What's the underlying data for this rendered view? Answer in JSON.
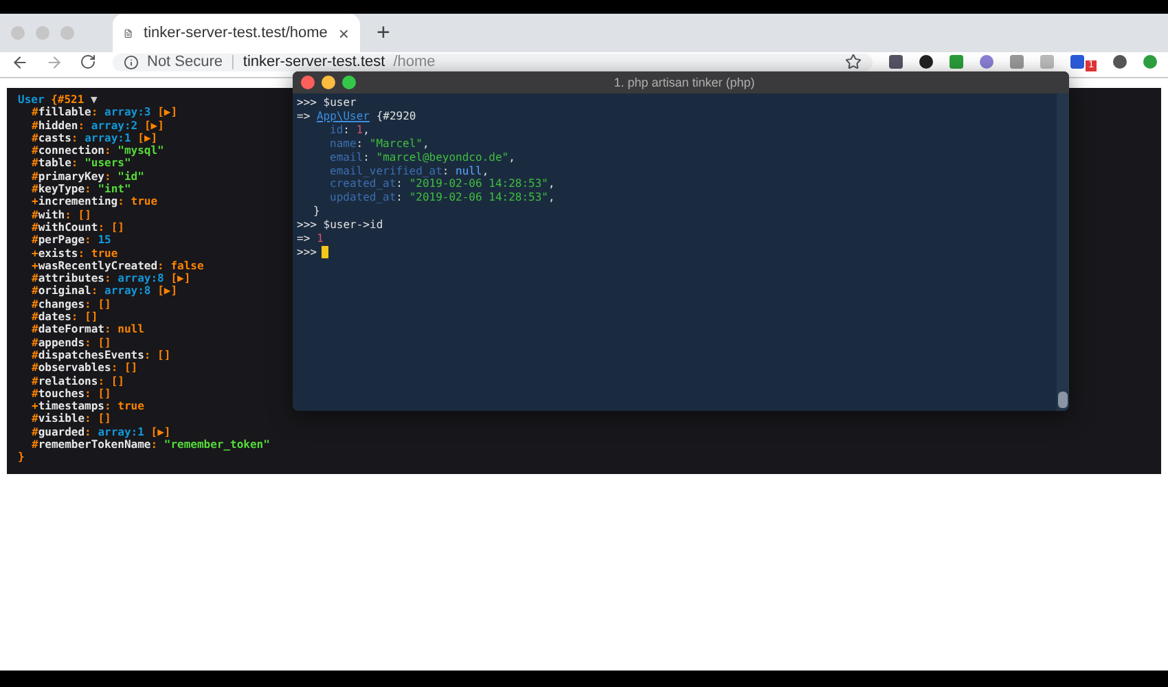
{
  "browser": {
    "tab": {
      "title": "tinker-server-test.test/home",
      "close": "×"
    },
    "new_tab": "+",
    "security": "Not Secure",
    "separator": "|",
    "url_host": "tinker-server-test.test",
    "url_path": "/home",
    "extension_badge": "1"
  },
  "dump": {
    "class": "User",
    "ref": "{#521",
    "toggle": "▼",
    "close": "}",
    "rows": [
      {
        "prefix": "#",
        "key": "fillable",
        "colon": ":",
        "kind": "array",
        "value": "array:3",
        "expander": "[▶]"
      },
      {
        "prefix": "#",
        "key": "hidden",
        "colon": ":",
        "kind": "array",
        "value": "array:2",
        "expander": "[▶]"
      },
      {
        "prefix": "#",
        "key": "casts",
        "colon": ":",
        "kind": "array",
        "value": "array:1",
        "expander": "[▶]"
      },
      {
        "prefix": "#",
        "key": "connection",
        "colon": ":",
        "kind": "string",
        "value": "\"mysql\""
      },
      {
        "prefix": "#",
        "key": "table",
        "colon": ":",
        "kind": "string",
        "value": "\"users\""
      },
      {
        "prefix": "#",
        "key": "primaryKey",
        "colon": ":",
        "kind": "string",
        "value": "\"id\""
      },
      {
        "prefix": "#",
        "key": "keyType",
        "colon": ":",
        "kind": "string",
        "value": "\"int\""
      },
      {
        "prefix": "+",
        "key": "incrementing",
        "colon": ":",
        "kind": "const",
        "value": "true"
      },
      {
        "prefix": "#",
        "key": "with",
        "colon": ":",
        "kind": "empty",
        "value": "[]"
      },
      {
        "prefix": "#",
        "key": "withCount",
        "colon": ":",
        "kind": "empty",
        "value": "[]"
      },
      {
        "prefix": "#",
        "key": "perPage",
        "colon": ":",
        "kind": "number",
        "value": "15"
      },
      {
        "prefix": "+",
        "key": "exists",
        "colon": ":",
        "kind": "const",
        "value": "true"
      },
      {
        "prefix": "+",
        "key": "wasRecentlyCreated",
        "colon": ":",
        "kind": "const",
        "value": "false"
      },
      {
        "prefix": "#",
        "key": "attributes",
        "colon": ":",
        "kind": "array",
        "value": "array:8",
        "expander": "[▶]"
      },
      {
        "prefix": "#",
        "key": "original",
        "colon": ":",
        "kind": "array",
        "value": "array:8",
        "expander": "[▶]"
      },
      {
        "prefix": "#",
        "key": "changes",
        "colon": ":",
        "kind": "empty",
        "value": "[]"
      },
      {
        "prefix": "#",
        "key": "dates",
        "colon": ":",
        "kind": "empty",
        "value": "[]"
      },
      {
        "prefix": "#",
        "key": "dateFormat",
        "colon": ":",
        "kind": "const",
        "value": "null"
      },
      {
        "prefix": "#",
        "key": "appends",
        "colon": ":",
        "kind": "empty",
        "value": "[]"
      },
      {
        "prefix": "#",
        "key": "dispatchesEvents",
        "colon": ":",
        "kind": "empty",
        "value": "[]"
      },
      {
        "prefix": "#",
        "key": "observables",
        "colon": ":",
        "kind": "empty",
        "value": "[]"
      },
      {
        "prefix": "#",
        "key": "relations",
        "colon": ":",
        "kind": "empty",
        "value": "[]"
      },
      {
        "prefix": "#",
        "key": "touches",
        "colon": ":",
        "kind": "empty",
        "value": "[]"
      },
      {
        "prefix": "+",
        "key": "timestamps",
        "colon": ":",
        "kind": "const",
        "value": "true"
      },
      {
        "prefix": "#",
        "key": "visible",
        "colon": ":",
        "kind": "empty",
        "value": "[]"
      },
      {
        "prefix": "#",
        "key": "guarded",
        "colon": ":",
        "kind": "array",
        "value": "array:1",
        "expander": "[▶]"
      },
      {
        "prefix": "#",
        "key": "rememberTokenName",
        "colon": ":",
        "kind": "string",
        "value": "\"remember_token\""
      }
    ]
  },
  "terminal": {
    "title": "1. php artisan tinker (php)",
    "lines": [
      {
        "kind": "input",
        "prompt": ">>>",
        "text": "$user"
      },
      {
        "kind": "object",
        "arrow": "=>",
        "class": "App\\User",
        "ref": "{#2920"
      },
      {
        "kind": "field",
        "key": "id",
        "colon": ":",
        "color": "#e0506a",
        "value": "1",
        "separator": ","
      },
      {
        "kind": "field",
        "key": "name",
        "colon": ":",
        "color": "#3fbf3f",
        "value": "\"Marcel\"",
        "separator": ","
      },
      {
        "kind": "field",
        "key": "email",
        "colon": ":",
        "color": "#3fbf3f",
        "value": "\"marcel@beyondco.de\"",
        "separator": ","
      },
      {
        "kind": "field",
        "key": "email_verified_at",
        "colon": ":",
        "color": "#5aa8ff",
        "value": "null",
        "separator": ","
      },
      {
        "kind": "field",
        "key": "created_at",
        "colon": ":",
        "color": "#3fbf3f",
        "value": "\"2019-02-06 14:28:53\"",
        "separator": ","
      },
      {
        "kind": "field",
        "key": "updated_at",
        "colon": ":",
        "color": "#3fbf3f",
        "value": "\"2019-02-06 14:28:53\"",
        "separator": ","
      },
      {
        "kind": "close",
        "text": "}"
      },
      {
        "kind": "input",
        "prompt": ">>>",
        "text": "$user->id"
      },
      {
        "kind": "result",
        "arrow": "=>",
        "color": "#e0506a",
        "value": "1"
      },
      {
        "kind": "input",
        "prompt": ">>>",
        "cursor": true
      }
    ]
  }
}
